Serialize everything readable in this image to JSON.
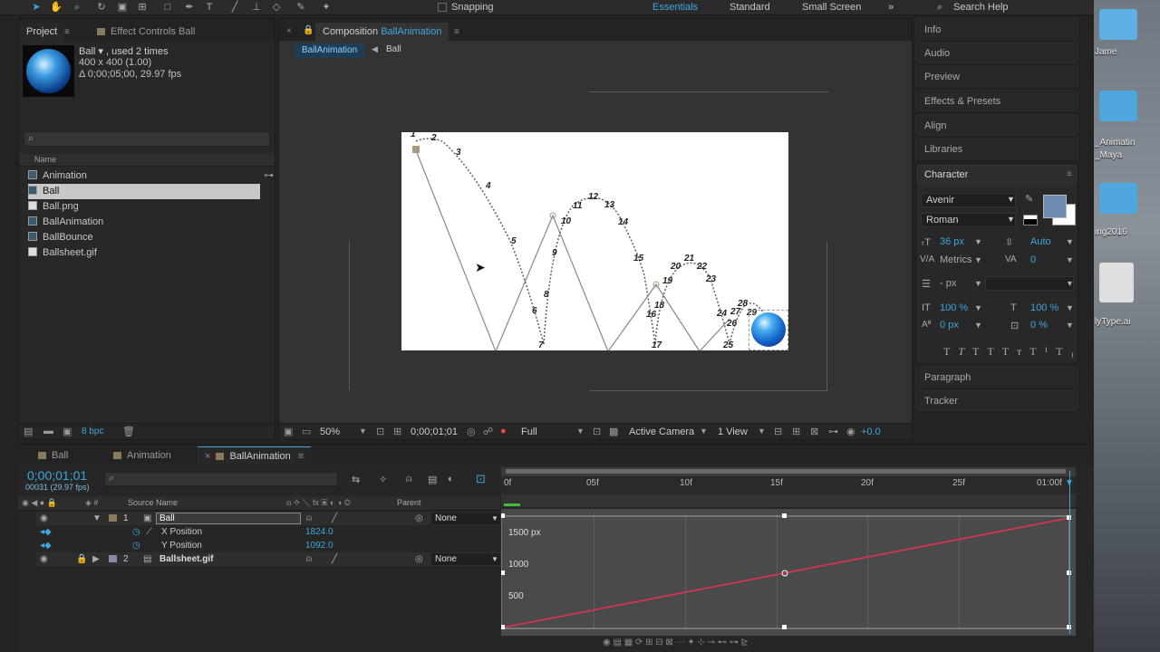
{
  "toolbar": {
    "snapping": "Snapping",
    "search_help": "Search Help"
  },
  "workspaces": [
    "Essentials",
    "Standard",
    "Small Screen"
  ],
  "project_panel": {
    "tab_project": "Project",
    "tab_effect_controls": "Effect Controls Ball",
    "item_name": "Ball ▾ , used 2 times",
    "item_size": "400 x 400 (1.00)",
    "item_duration": "Δ 0;00;05;00, 29.97 fps",
    "search_placeholder": "",
    "column_name": "Name",
    "items": [
      "Animation",
      "Ball",
      "Ball.png",
      "BallAnimation",
      "BallBounce",
      "Ballsheet.gif"
    ],
    "bpc": "8 bpc"
  },
  "composition_panel": {
    "title_prefix": "Composition",
    "title_name": "BallAnimation",
    "breadcrumb_comp": "BallAnimation",
    "breadcrumb_layer": "Ball",
    "zoom": "50%",
    "timecode": "0;00;01;01",
    "resolution": "Full",
    "camera": "Active Camera",
    "views": "1 View",
    "exposure": "+0.0",
    "frame_numbers": [
      "1",
      "2",
      "3",
      "4",
      "5",
      "6",
      "7",
      "8",
      "9",
      "10",
      "11",
      "12",
      "13",
      "14",
      "15",
      "16",
      "17",
      "18",
      "19",
      "20",
      "21",
      "22",
      "23",
      "24",
      "25",
      "26",
      "27",
      "28",
      "29"
    ]
  },
  "right_panel": {
    "items": [
      "Info",
      "Audio",
      "Preview",
      "Effects & Presets",
      "Align",
      "Libraries"
    ],
    "character_title": "Character",
    "font": "Avenir",
    "style": "Roman",
    "font_size": "36 px",
    "leading": "Auto",
    "kerning": "Metrics",
    "tracking": "0",
    "stroke": "- px",
    "vert_scale": "100 %",
    "horiz_scale": "100 %",
    "baseline": "0 px",
    "tsume": "0 %",
    "paragraph": "Paragraph",
    "tracker": "Tracker",
    "colors": {
      "fill": "#6f8bb0",
      "stroke": "#ffffff"
    }
  },
  "timeline_panel": {
    "tabs": [
      "Ball",
      "Animation",
      "BallAnimation"
    ],
    "timecode": "0;00;01;01",
    "frame_info": "00031 (29.97 fps)",
    "col_source": "Source Name",
    "col_parent": "Parent",
    "layers": [
      {
        "num": "1",
        "name": "Ball",
        "parent": "None"
      },
      {
        "num": "2",
        "name": "Ballsheet.gif",
        "parent": "None"
      }
    ],
    "props": [
      {
        "name": "X Position",
        "value": "1824.0"
      },
      {
        "name": "Y Position",
        "value": "1092.0"
      }
    ],
    "ruler": [
      "0f",
      "05f",
      "10f",
      "15f",
      "20f",
      "25f",
      "01:00f"
    ],
    "graph_labels": [
      "1500 px",
      "1000",
      "500"
    ]
  },
  "desktop": {
    "labels": [
      "Jame",
      "_Animatin",
      "_Maya",
      "ing2016",
      "lyType.ai"
    ]
  }
}
